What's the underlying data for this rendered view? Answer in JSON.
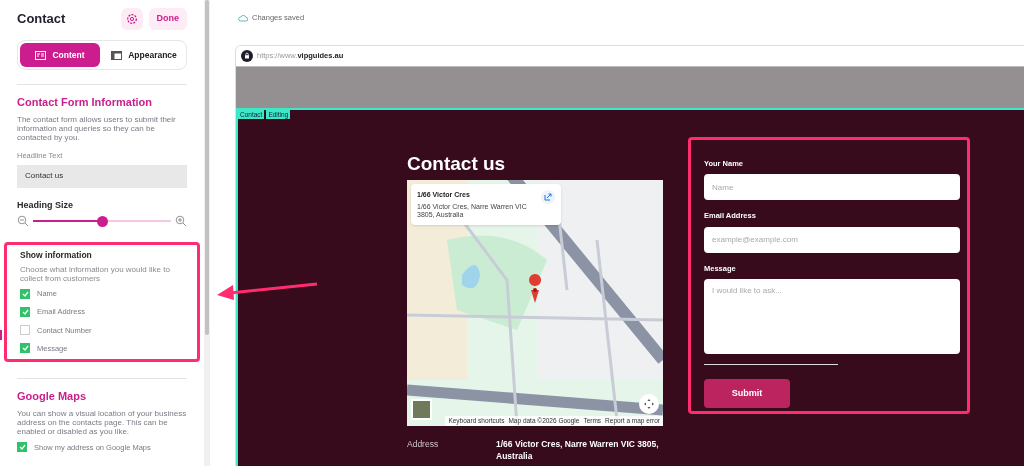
{
  "panel": {
    "title": "Contact",
    "done_label": "Done",
    "tabs": [
      {
        "label": "Content",
        "selected": true
      },
      {
        "label": "Appearance",
        "selected": false
      }
    ],
    "form_section": {
      "title": "Contact Form Information",
      "description": "The contact form allows users to submit their information and queries so they can be contacted by you.",
      "headline_label": "Headline Text",
      "headline_value": "Contact us",
      "heading_size": {
        "label": "Heading Size",
        "level": 0.5
      }
    },
    "show_information": {
      "title": "Show information",
      "description": "Choose what information you would like to collect from customers",
      "options": [
        {
          "label": "Name",
          "checked": true
        },
        {
          "label": "Email Address",
          "checked": true
        },
        {
          "label": "Contact Number",
          "checked": false
        },
        {
          "label": "Message",
          "checked": true
        }
      ]
    },
    "maps_section": {
      "title": "Google Maps",
      "description": "You can show a visual location of your business address on the contacts page. This can be enabled or disabled as you like.",
      "option": {
        "label": "Show my address on Google Maps",
        "checked": true
      }
    }
  },
  "status": "Changes saved",
  "browser": {
    "url_prefix": "https://www.",
    "url_domain": "vipguides.au",
    "tags": [
      "Contact",
      "Editing"
    ]
  },
  "page": {
    "heading": "Contact us",
    "map": {
      "place_title": "1/66 Victor Cres",
      "place_address": "1/66 Victor Cres, Narre Warren VIC 3805, Australia",
      "footer": [
        "Keyboard shortcuts",
        "Map data ©2026 Google",
        "Terms",
        "Report a map error"
      ]
    },
    "address_label": "Address",
    "address_value": "1/66 Victor Cres, Narre Warren VIC 3805, Australia",
    "form": {
      "fields": [
        {
          "label": "Your Name",
          "placeholder": "Name",
          "kind": "input"
        },
        {
          "label": "Email Address",
          "placeholder": "example@example.com",
          "kind": "input"
        },
        {
          "label": "Message",
          "placeholder": "I would like to ask...",
          "kind": "textarea"
        }
      ],
      "submit": "Submit"
    }
  }
}
